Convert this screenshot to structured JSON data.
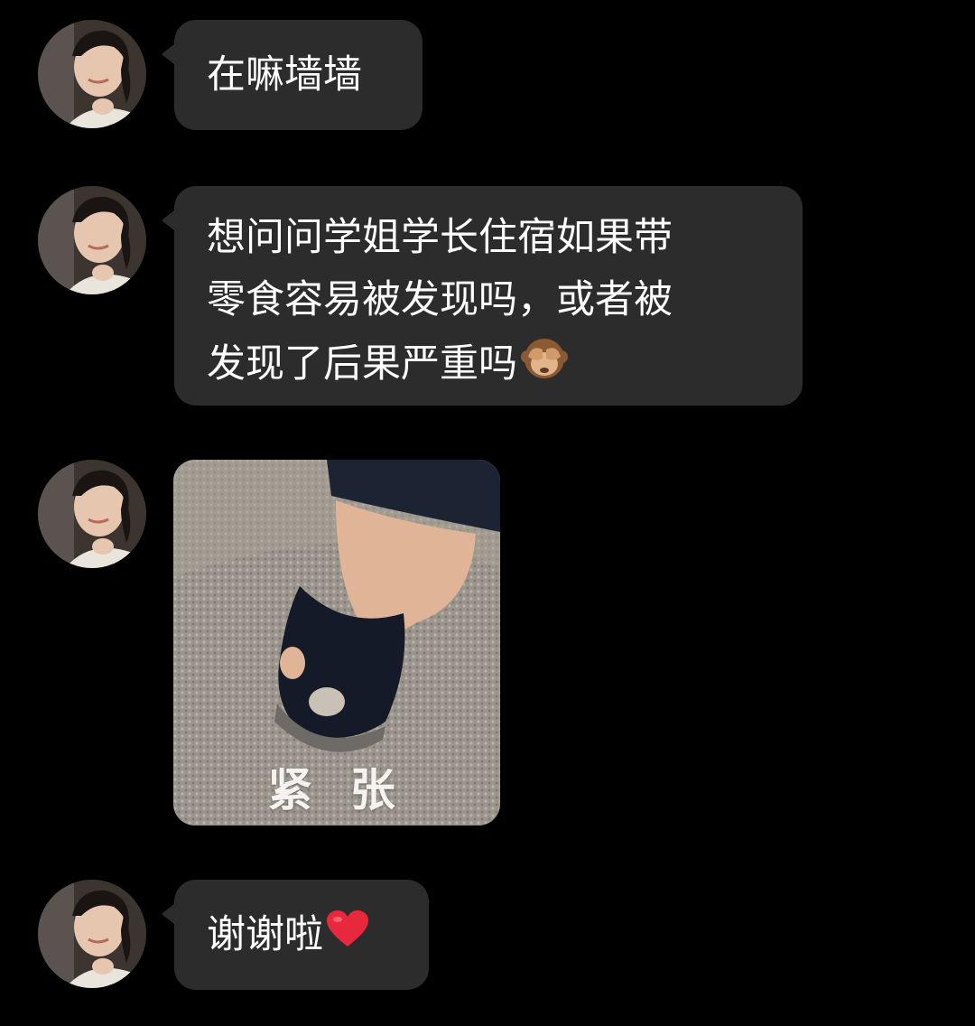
{
  "messages": [
    {
      "type": "text",
      "lines": [
        "在嘛墙墙"
      ]
    },
    {
      "type": "text",
      "lines": [
        "想问问学姐学长住宿如果带",
        "零食容易被发现吗，或者被",
        "发现了后果严重吗"
      ],
      "trailing_emoji": "see-no-evil-monkey"
    },
    {
      "type": "sticker",
      "caption": "紧 张"
    },
    {
      "type": "text",
      "lines": [
        "谢谢啦"
      ],
      "trailing_emoji": "red-heart"
    }
  ],
  "colors": {
    "background": "#000000",
    "bubble": "#2c2c2c",
    "text": "#ffffff"
  }
}
